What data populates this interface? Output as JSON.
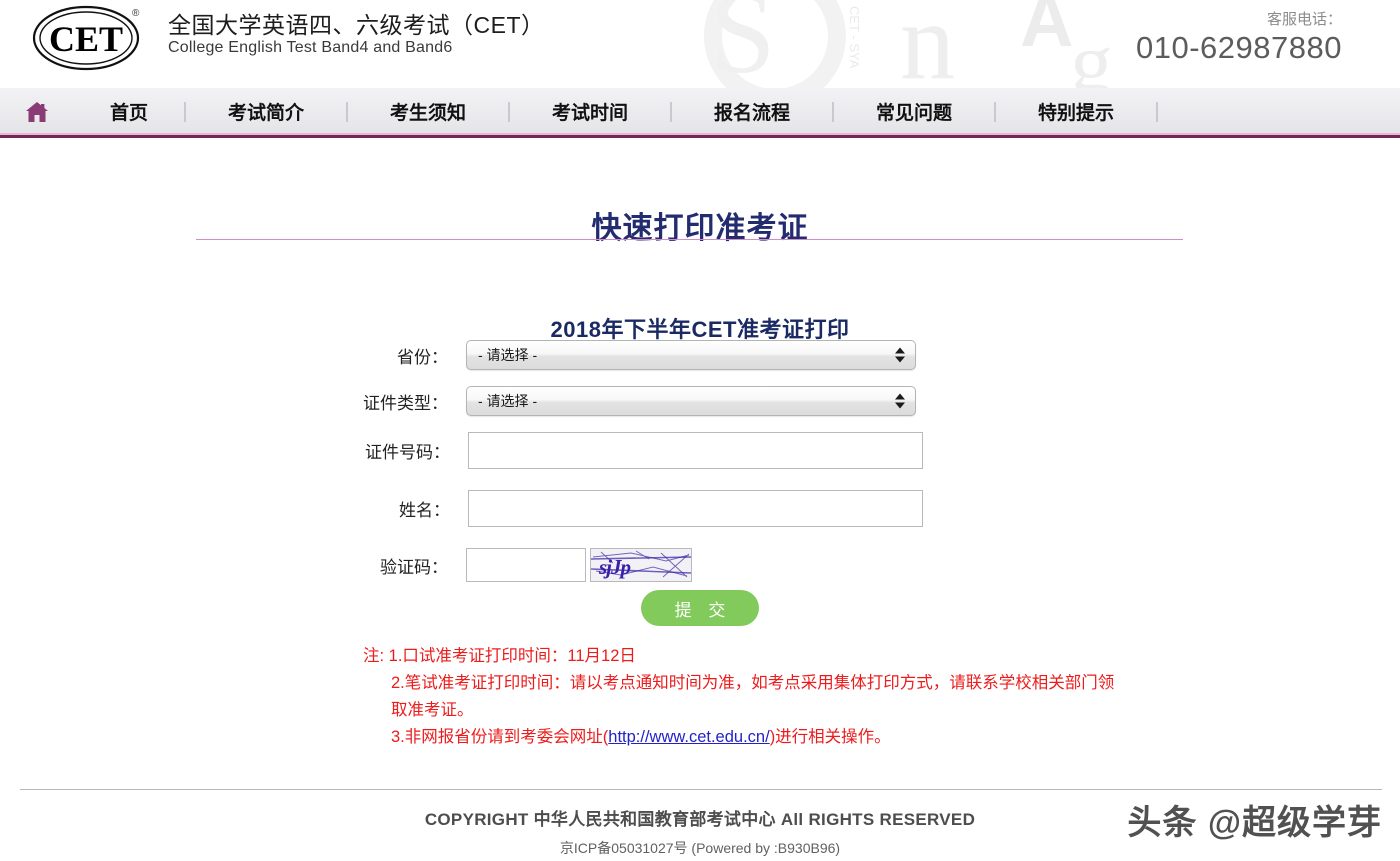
{
  "header": {
    "logo_text": "CET",
    "logo_registered": "®",
    "brand_cn": "全国大学英语四、六级考试（CET）",
    "brand_en": "College English Test Band4 and Band6",
    "service_label": "客服电话：",
    "service_phone": "010-62987880",
    "watermark_letters": "CET"
  },
  "nav": {
    "home_icon": "home-icon",
    "items": [
      {
        "label": "首页"
      },
      {
        "label": "考试简介"
      },
      {
        "label": "考生须知"
      },
      {
        "label": "考试时间"
      },
      {
        "label": "报名流程"
      },
      {
        "label": "常见问题"
      },
      {
        "label": "特别提示"
      }
    ]
  },
  "main": {
    "page_title": "快速打印准考证",
    "form_heading": "2018年下半年CET准考证打印",
    "fields": {
      "province": {
        "label": "省份：",
        "value": "- 请选择 -",
        "placeholder": "- 请选择 -"
      },
      "id_type": {
        "label": "证件类型：",
        "value": "- 请选择 -",
        "placeholder": "- 请选择 -"
      },
      "id_number": {
        "label": "证件号码：",
        "value": "",
        "placeholder": ""
      },
      "name": {
        "label": "姓名：",
        "value": "",
        "placeholder": ""
      },
      "captcha": {
        "label": "验证码：",
        "value": "",
        "placeholder": "",
        "image_text": "sjJp"
      }
    },
    "submit_label": "提 交"
  },
  "notes": {
    "line1": "注: 1.口试准考证打印时间：11月12日",
    "line2": "2.笔试准考证打印时间：请以考点通知时间为准，如考点采用集体打印方式，请联系学校相关部门领取准考证。",
    "line3_prefix": "3.非网报省份请到考委会网址(",
    "line3_link": "http://www.cet.edu.cn/",
    "line3_suffix": ")进行相关操作。"
  },
  "footer": {
    "copyright": "COPYRIGHT 中华人民共和国教育部考试中心 All RIGHTS RESERVED",
    "icp": "京ICP备05031027号 (Powered by :B930B96)",
    "watermark": "头条 @超级学芽"
  },
  "colors": {
    "nav_border": "#74285a",
    "nav_accent": "#e9b6d8",
    "title_blue": "#232c6e",
    "rule_purple": "#cf8ec8",
    "submit_green": "#82ca5b",
    "note_red": "#ed1c1c",
    "link_blue": "#2222cc",
    "captcha_purple": "#3a1fa8"
  }
}
